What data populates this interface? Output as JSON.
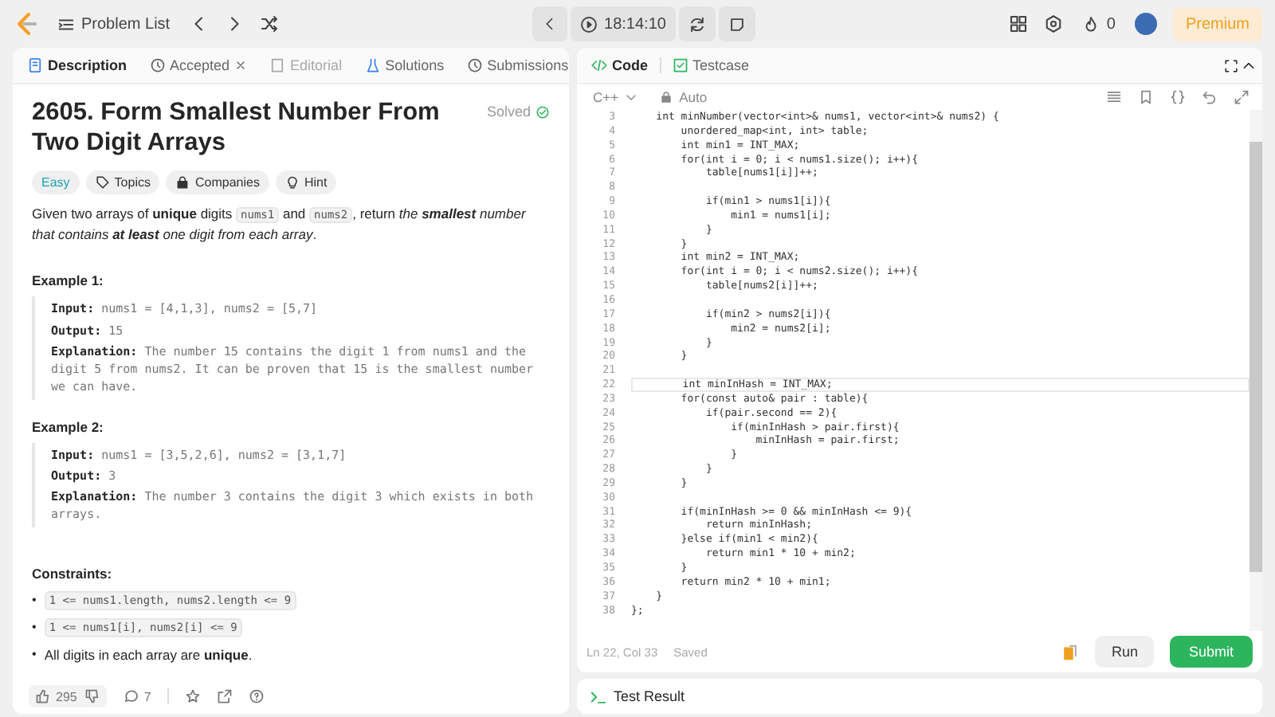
{
  "topbar": {
    "problem_list": "Problem List",
    "timer": "18:14:10",
    "streak": "0",
    "premium": "Premium"
  },
  "left_tabs": [
    {
      "label": "Description",
      "selected": true,
      "disabled": false,
      "closable": false
    },
    {
      "label": "Accepted",
      "selected": false,
      "disabled": false,
      "closable": true
    },
    {
      "label": "Editorial",
      "selected": false,
      "disabled": true,
      "closable": false
    },
    {
      "label": "Solutions",
      "selected": false,
      "disabled": false,
      "closable": false
    },
    {
      "label": "Submissions",
      "selected": false,
      "disabled": false,
      "closable": false
    }
  ],
  "problem": {
    "title": "2605. Form Smallest Number From Two Digit Arrays",
    "status": "Solved",
    "difficulty": "Easy",
    "tags": [
      "Topics",
      "Companies",
      "Hint"
    ],
    "statement": [
      {
        "kind": "text",
        "text": "Given two arrays of **unique** digits "
      },
      {
        "kind": "code",
        "text": "nums1"
      },
      {
        "kind": "text",
        "text": " and "
      },
      {
        "kind": "code",
        "text": "nums2"
      },
      {
        "kind": "text",
        "text": ", return "
      },
      {
        "kind": "italic",
        "text": "the **smallest** number that contains **at least** one digit from each array"
      },
      {
        "kind": "text",
        "text": "."
      }
    ],
    "examples": [
      {
        "title": "Example 1:",
        "lines": [
          {
            "label": "Input:",
            "text": "nums1 = [4,1,3], nums2 = [5,7]"
          },
          {
            "label": "Output:",
            "text": "15"
          },
          {
            "label": "Explanation:",
            "text": "The number 15 contains the digit 1 from nums1 and the digit 5 from nums2. It can be proven that 15 is the smallest number we can have."
          }
        ]
      },
      {
        "title": "Example 2:",
        "lines": [
          {
            "label": "Input:",
            "text": "nums1 = [3,5,2,6], nums2 = [3,1,7]"
          },
          {
            "label": "Output:",
            "text": "3"
          },
          {
            "label": "Explanation:",
            "text": "The number 3 contains the digit 3 which exists in both arrays."
          }
        ]
      }
    ],
    "constraints_title": "Constraints:",
    "constraints": [
      {
        "kind": "code",
        "bullet": "•",
        "text": "1 <= nums1.length, nums2.length <= 9"
      },
      {
        "kind": "code",
        "bullet": "•",
        "text": "1 <= nums1[i], nums2[i] <= 9"
      },
      {
        "kind": "text",
        "bullet": "•",
        "text": "All digits in each array are **unique**."
      }
    ]
  },
  "footer": {
    "likes": "295",
    "comments": "7"
  },
  "right_tabs": [
    {
      "label": "Code",
      "selected": true
    },
    {
      "label": "Testcase",
      "selected": false
    }
  ],
  "editor": {
    "language": "C++",
    "mode": "Auto",
    "lines": [
      {
        "number": "3",
        "current": false,
        "text": "    int minNumber(vector<int>& nums1, vector<int>& nums2) {"
      },
      {
        "number": "4",
        "current": false,
        "text": "        unordered_map<int, int> table;"
      },
      {
        "number": "5",
        "current": false,
        "text": "        int min1 = INT_MAX;"
      },
      {
        "number": "6",
        "current": false,
        "text": "        for(int i = 0; i < nums1.size(); i++){"
      },
      {
        "number": "7",
        "current": false,
        "text": "            table[nums1[i]]++;"
      },
      {
        "number": "8",
        "current": false
      },
      {
        "number": "9",
        "current": false,
        "text": "            if(min1 > nums1[i]){"
      },
      {
        "number": "10",
        "current": false,
        "text": "                min1 = nums1[i];"
      },
      {
        "number": "11",
        "current": false,
        "text": "            }"
      },
      {
        "number": "12",
        "current": false,
        "text": "        }"
      },
      {
        "number": "13",
        "current": false,
        "text": "        int min2 = INT_MAX;"
      },
      {
        "number": "14",
        "current": false,
        "text": "        for(int i = 0; i < nums2.size(); i++){"
      },
      {
        "number": "15",
        "current": false,
        "text": "            table[nums2[i]]++;"
      },
      {
        "number": "16",
        "current": false
      },
      {
        "number": "17",
        "current": false,
        "text": "            if(min2 > nums2[i]){"
      },
      {
        "number": "18",
        "current": false,
        "text": "                min2 = nums2[i];"
      },
      {
        "number": "19",
        "current": false,
        "text": "            }"
      },
      {
        "number": "20",
        "current": false,
        "text": "        }"
      },
      {
        "number": "21",
        "current": false
      },
      {
        "number": "22",
        "current": true,
        "text": "        int minInHash = INT_MAX;"
      },
      {
        "number": "23",
        "current": false,
        "text": "        for(const auto& pair : table){"
      },
      {
        "number": "24",
        "current": false,
        "text": "            if(pair.second == 2){"
      },
      {
        "number": "25",
        "current": false,
        "text": "                if(minInHash > pair.first){"
      },
      {
        "number": "26",
        "current": false,
        "text": "                    minInHash = pair.first;"
      },
      {
        "number": "27",
        "current": false,
        "text": "                }"
      },
      {
        "number": "28",
        "current": false,
        "text": "            }"
      },
      {
        "number": "29",
        "current": false,
        "text": "        }"
      },
      {
        "number": "30",
        "current": false
      },
      {
        "number": "31",
        "current": false,
        "text": "        if(minInHash >= 0 && minInHash <= 9){"
      },
      {
        "number": "32",
        "current": false,
        "text": "            return minInHash;"
      },
      {
        "number": "33",
        "current": false,
        "text": "        }else if(min1 < min2){"
      },
      {
        "number": "34",
        "current": false,
        "text": "            return min1 * 10 + min2;"
      },
      {
        "number": "35",
        "current": false,
        "text": "        }"
      },
      {
        "number": "36",
        "current": false,
        "text": "        return min2 * 10 + min1;"
      },
      {
        "number": "37",
        "current": false,
        "text": "    }"
      },
      {
        "number": "38",
        "current": false,
        "text": "};"
      }
    ],
    "position": "Ln 22, Col 33",
    "save_state": "Saved",
    "run": "Run",
    "submit": "Submit"
  },
  "test_result": "Test Result"
}
